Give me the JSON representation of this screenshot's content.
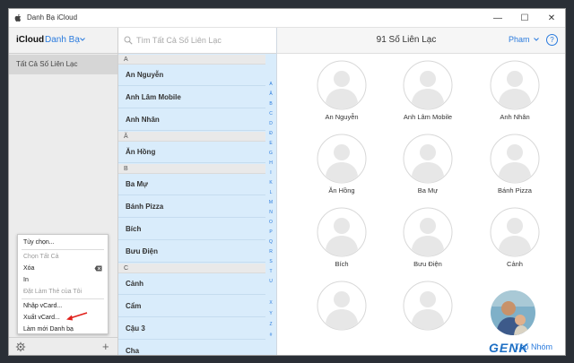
{
  "window": {
    "title": "Danh Bạ iCloud",
    "minimize": "—",
    "maximize": "☐",
    "close": "✕"
  },
  "sidebar": {
    "brand": "iCloud",
    "app": "Danh Bạ",
    "all_contacts": "Tất Cả Số Liên Lạc"
  },
  "context_menu": {
    "items": [
      {
        "label": "Tùy chọn...",
        "enabled": true
      },
      {
        "label": "Chọn Tất Cả",
        "enabled": false
      },
      {
        "label": "Xóa",
        "enabled": true
      },
      {
        "label": "In",
        "enabled": true
      },
      {
        "label": "Đặt Làm Thẻ của Tôi",
        "enabled": false
      },
      {
        "label": "Nhập vCard...",
        "enabled": true
      },
      {
        "label": "Xuất vCard...",
        "enabled": true
      },
      {
        "label": "Làm mới Danh bạ",
        "enabled": true
      }
    ]
  },
  "search": {
    "placeholder": "Tìm Tất Cả Số Liên Lạc"
  },
  "list": {
    "sections": [
      {
        "letter": "A",
        "contacts": [
          "An Nguyễn",
          "Anh Lâm Mobile",
          "Anh Nhân"
        ]
      },
      {
        "letter": "Ă",
        "contacts": [
          "Ăn Hồng"
        ]
      },
      {
        "letter": "B",
        "contacts": [
          "Ba Mự",
          "Bánh Pizza",
          "Bích",
          "Bưu Điện"
        ]
      },
      {
        "letter": "C",
        "contacts": [
          "Cảnh",
          "Cẩm",
          "Cậu 3",
          "Cha"
        ]
      }
    ],
    "index": [
      "A",
      "Ă",
      "B",
      "C",
      "D",
      "Đ",
      "E",
      "G",
      "H",
      "I",
      "K",
      "L",
      "M",
      "N",
      "O",
      "P",
      "Q",
      "R",
      "S",
      "T",
      "U",
      "X",
      "Y",
      "Z",
      "#"
    ]
  },
  "main": {
    "count": "91 Số Liên Lạc",
    "user": "Pham",
    "help": "?",
    "cards": [
      "An Nguyễn",
      "Anh Lâm Mobile",
      "Anh Nhân",
      "Ăn Hồng",
      "Ba Mự",
      "Bánh Pizza",
      "Bích",
      "Bưu Điện",
      "Cảnh"
    ],
    "new_group": "Tạo Nhóm"
  },
  "watermark": "GENK",
  "colors": {
    "accent": "#2a7bde",
    "list_bg": "#d9ecfb",
    "annotation": "#e0201b"
  }
}
